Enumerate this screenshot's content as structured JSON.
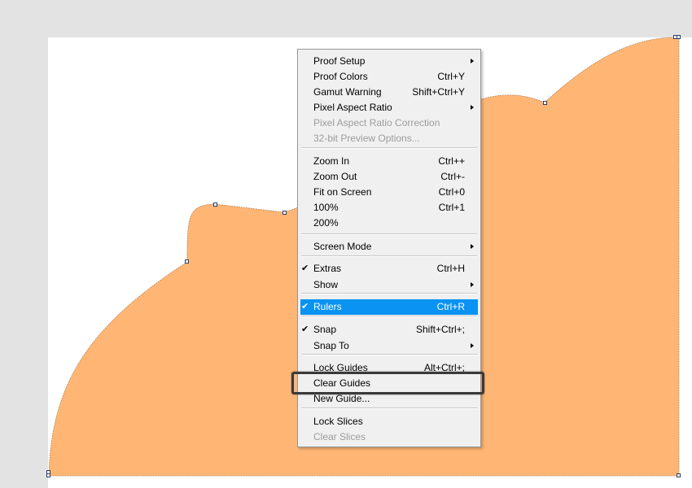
{
  "colors": {
    "workspace": "#e3e3e3",
    "canvas": "#ffffff",
    "shape_fill": "#ffb675",
    "menu_bg": "#f0f0f0",
    "selected_bg": "#0a93f2",
    "disabled_text": "#9c9c9c",
    "highlight_border": "#3a3a3a"
  },
  "context_menu": {
    "items": [
      {
        "label": "Proof Setup",
        "shortcut": "",
        "submenu": true,
        "disabled": false,
        "checked": false,
        "selected": false
      },
      {
        "label": "Proof Colors",
        "shortcut": "Ctrl+Y",
        "submenu": false,
        "disabled": false,
        "checked": false,
        "selected": false
      },
      {
        "label": "Gamut Warning",
        "shortcut": "Shift+Ctrl+Y",
        "submenu": false,
        "disabled": false,
        "checked": false,
        "selected": false
      },
      {
        "label": "Pixel Aspect Ratio",
        "shortcut": "",
        "submenu": true,
        "disabled": false,
        "checked": false,
        "selected": false
      },
      {
        "label": "Pixel Aspect Ratio Correction",
        "shortcut": "",
        "submenu": false,
        "disabled": true,
        "checked": false,
        "selected": false
      },
      {
        "label": "32-bit Preview Options...",
        "shortcut": "",
        "submenu": false,
        "disabled": true,
        "checked": false,
        "selected": false
      },
      {
        "label": "Zoom In",
        "shortcut": "Ctrl++",
        "submenu": false,
        "disabled": false,
        "checked": false,
        "selected": false
      },
      {
        "label": "Zoom Out",
        "shortcut": "Ctrl+-",
        "submenu": false,
        "disabled": false,
        "checked": false,
        "selected": false
      },
      {
        "label": "Fit on Screen",
        "shortcut": "Ctrl+0",
        "submenu": false,
        "disabled": false,
        "checked": false,
        "selected": false
      },
      {
        "label": "100%",
        "shortcut": "Ctrl+1",
        "submenu": false,
        "disabled": false,
        "checked": false,
        "selected": false
      },
      {
        "label": "200%",
        "shortcut": "",
        "submenu": false,
        "disabled": false,
        "checked": false,
        "selected": false
      },
      {
        "label": "Screen Mode",
        "shortcut": "",
        "submenu": true,
        "disabled": false,
        "checked": false,
        "selected": false
      },
      {
        "label": "Extras",
        "shortcut": "Ctrl+H",
        "submenu": false,
        "disabled": false,
        "checked": true,
        "selected": false
      },
      {
        "label": "Show",
        "shortcut": "",
        "submenu": true,
        "disabled": false,
        "checked": false,
        "selected": false
      },
      {
        "label": "Rulers",
        "shortcut": "Ctrl+R",
        "submenu": false,
        "disabled": false,
        "checked": true,
        "selected": true
      },
      {
        "label": "Snap",
        "shortcut": "Shift+Ctrl+;",
        "submenu": false,
        "disabled": false,
        "checked": true,
        "selected": false
      },
      {
        "label": "Snap To",
        "shortcut": "",
        "submenu": true,
        "disabled": false,
        "checked": false,
        "selected": false
      },
      {
        "label": "Lock Guides",
        "shortcut": "Alt+Ctrl+;",
        "submenu": false,
        "disabled": false,
        "checked": false,
        "selected": false
      },
      {
        "label": "Clear Guides",
        "shortcut": "",
        "submenu": false,
        "disabled": false,
        "checked": false,
        "selected": false
      },
      {
        "label": "New Guide...",
        "shortcut": "",
        "submenu": false,
        "disabled": false,
        "checked": false,
        "selected": false
      },
      {
        "label": "Lock Slices",
        "shortcut": "",
        "submenu": false,
        "disabled": false,
        "checked": false,
        "selected": false
      },
      {
        "label": "Clear Slices",
        "shortcut": "",
        "submenu": false,
        "disabled": true,
        "checked": false,
        "selected": false
      }
    ],
    "check_glyph": "✔"
  }
}
